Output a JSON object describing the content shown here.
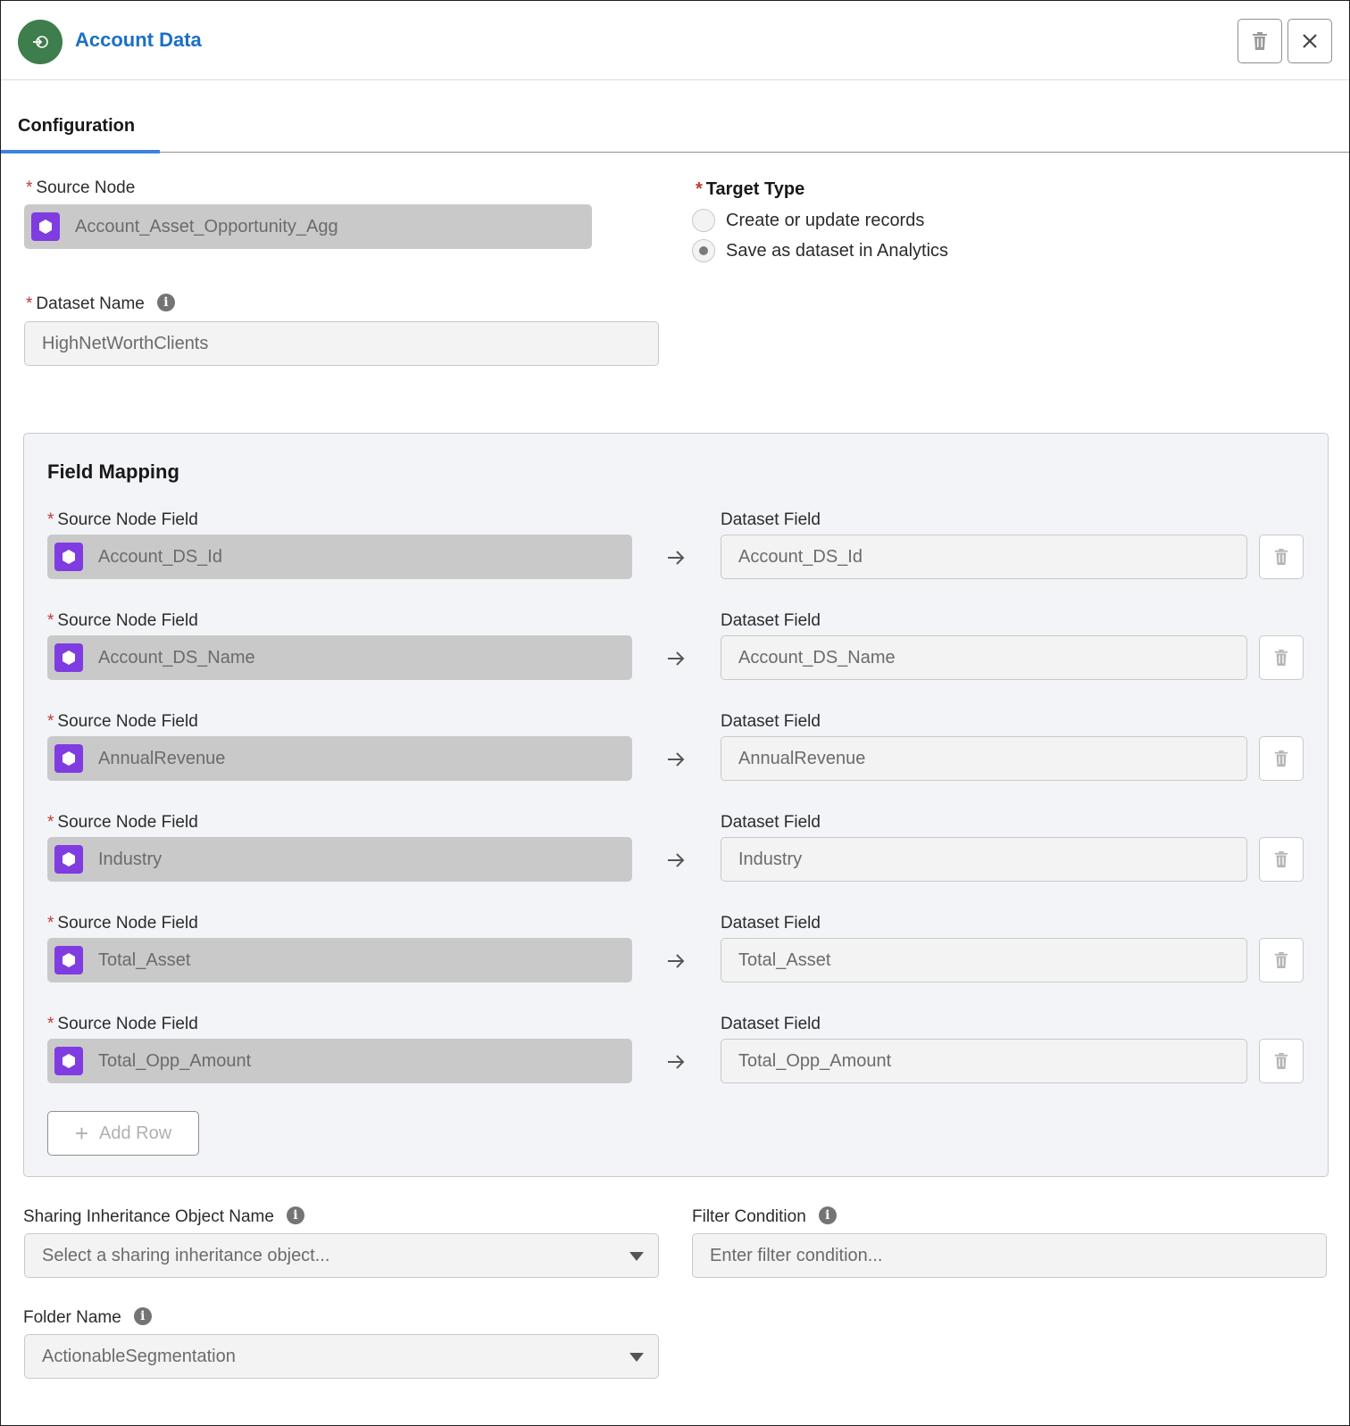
{
  "header": {
    "title": "Account Data",
    "icon": "output-node-icon",
    "accent_color": "#3e7d4c",
    "delete_button_icon": "trash-icon",
    "close_button_icon": "close-icon"
  },
  "tabs": [
    {
      "label": "Configuration",
      "active": true
    }
  ],
  "form": {
    "source_node": {
      "label": "Source Node",
      "required": true,
      "value": "Account_Asset_Opportunity_Agg"
    },
    "target_type": {
      "label": "Target Type",
      "required": true,
      "options": [
        {
          "label": "Create or update records",
          "selected": false
        },
        {
          "label": "Save as dataset in Analytics",
          "selected": true
        }
      ]
    },
    "dataset_name": {
      "label": "Dataset Name",
      "required": true,
      "value": "HighNetWorthClients"
    }
  },
  "field_mapping": {
    "title": "Field Mapping",
    "source_label": "Source Node Field",
    "dest_label": "Dataset Field",
    "rows": [
      {
        "source": "Account_DS_Id",
        "dest": "Account_DS_Id"
      },
      {
        "source": "Account_DS_Name",
        "dest": "Account_DS_Name"
      },
      {
        "source": "AnnualRevenue",
        "dest": "AnnualRevenue"
      },
      {
        "source": "Industry",
        "dest": "Industry"
      },
      {
        "source": "Total_Asset",
        "dest": "Total_Asset"
      },
      {
        "source": "Total_Opp_Amount",
        "dest": "Total_Opp_Amount"
      }
    ],
    "add_row_label": "Add Row"
  },
  "sharing": {
    "label": "Sharing Inheritance Object Name",
    "placeholder": "Select a sharing inheritance object..."
  },
  "filter": {
    "label": "Filter Condition",
    "placeholder": "Enter filter condition..."
  },
  "folder": {
    "label": "Folder Name",
    "value": "ActionableSegmentation"
  }
}
